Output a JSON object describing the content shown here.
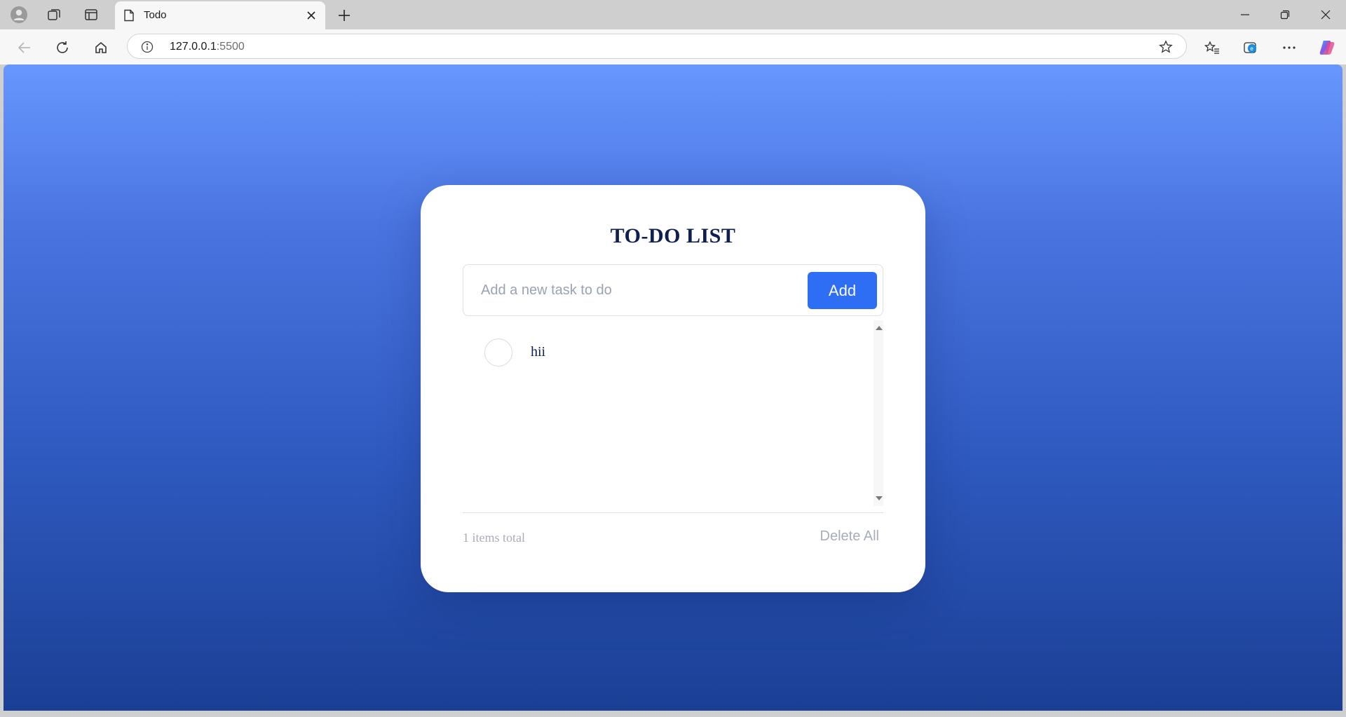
{
  "browser": {
    "tab": {
      "title": "Todo",
      "favicon": "page-icon"
    },
    "address": {
      "host": "127.0.0.1",
      "port": ":5500"
    },
    "icons": {
      "profile": "profile-icon",
      "workspaces": "workspaces-icon",
      "tab_actions": "tab-actions-icon",
      "new_tab": "plus-icon",
      "close_tab": "close-icon",
      "minimize": "minimize-icon",
      "restore": "restore-icon",
      "close_window": "close-icon",
      "back": "back-arrow-icon",
      "refresh": "refresh-icon",
      "home": "home-icon",
      "info": "info-icon",
      "favorite": "star-icon",
      "favorites": "favorites-icon",
      "collections": "collections-icon",
      "more": "more-icon",
      "copilot": "copilot-icon"
    }
  },
  "app": {
    "title": "TO-DO LIST",
    "input": {
      "placeholder": "Add a new task to do",
      "value": ""
    },
    "add_label": "Add",
    "tasks": [
      {
        "text": "hii",
        "done": false
      }
    ],
    "footer": {
      "count_text": "1 items total",
      "delete_all_label": "Delete All"
    },
    "colors": {
      "accent": "#2d6ef5",
      "title": "#0e1f52",
      "muted": "#a7adb9",
      "bg_top": "#6797ff",
      "bg_bottom": "#1a3f95"
    }
  }
}
